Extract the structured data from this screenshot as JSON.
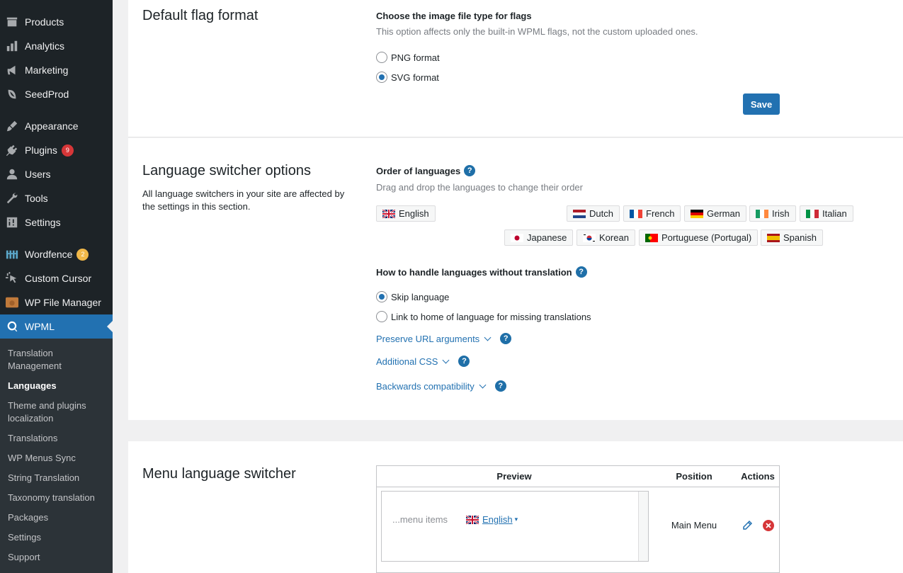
{
  "sidebar": {
    "items": [
      {
        "label": "Products",
        "icon": "products-icon"
      },
      {
        "label": "Analytics",
        "icon": "analytics-icon"
      },
      {
        "label": "Marketing",
        "icon": "marketing-icon"
      },
      {
        "label": "SeedProd",
        "icon": "seedprod-icon"
      },
      {
        "label": "Appearance",
        "icon": "appearance-icon"
      },
      {
        "label": "Plugins",
        "icon": "plugins-icon",
        "badge": "9"
      },
      {
        "label": "Users",
        "icon": "users-icon"
      },
      {
        "label": "Tools",
        "icon": "tools-icon"
      },
      {
        "label": "Settings",
        "icon": "settings-icon"
      },
      {
        "label": "Wordfence",
        "icon": "wordfence-icon",
        "badge": "2"
      },
      {
        "label": "Custom Cursor",
        "icon": "cursor-icon"
      },
      {
        "label": "WP File Manager",
        "icon": "file-manager-icon"
      },
      {
        "label": "WPML",
        "icon": "wpml-icon"
      }
    ],
    "submenu": [
      "Translation Management",
      "Languages",
      "Theme and plugins localization",
      "Translations",
      "WP Menus Sync",
      "String Translation",
      "Taxonomy translation",
      "Packages",
      "Settings",
      "Support"
    ]
  },
  "flag_format": {
    "title": "Default flag format",
    "label": "Choose the image file type for flags",
    "hint": "This option affects only the built-in WPML flags, not the custom uploaded ones.",
    "options": [
      "PNG format",
      "SVG format"
    ],
    "selected": "SVG format",
    "save_label": "Save"
  },
  "switcher_options": {
    "title": "Language switcher options",
    "description": "All language switchers in your site are affected by the settings in this section.",
    "order_label": "Order of languages",
    "order_hint": "Drag and drop the languages to change their order",
    "languages": [
      "English",
      "Dutch",
      "French",
      "German",
      "Irish",
      "Italian",
      "Japanese",
      "Korean",
      "Portuguese (Portugal)",
      "Spanish"
    ],
    "missing_label": "How to handle languages without translation",
    "missing_options": [
      "Skip language",
      "Link to home of language for missing translations"
    ],
    "missing_selected": "Skip language",
    "links": [
      "Preserve URL arguments",
      "Additional CSS",
      "Backwards compatibility"
    ],
    "help_glyph": "?"
  },
  "menu_switcher": {
    "title": "Menu language switcher",
    "col_preview": "Preview",
    "col_position": "Position",
    "col_actions": "Actions",
    "preview_menu_items": "...menu items",
    "preview_language": "English",
    "preview_caret": "▾",
    "position": "Main Menu"
  },
  "colors": {
    "accent": "#2271b1",
    "sidebar_bg": "#1d2327",
    "submenu_bg": "#2c3338",
    "danger": "#d63638"
  }
}
